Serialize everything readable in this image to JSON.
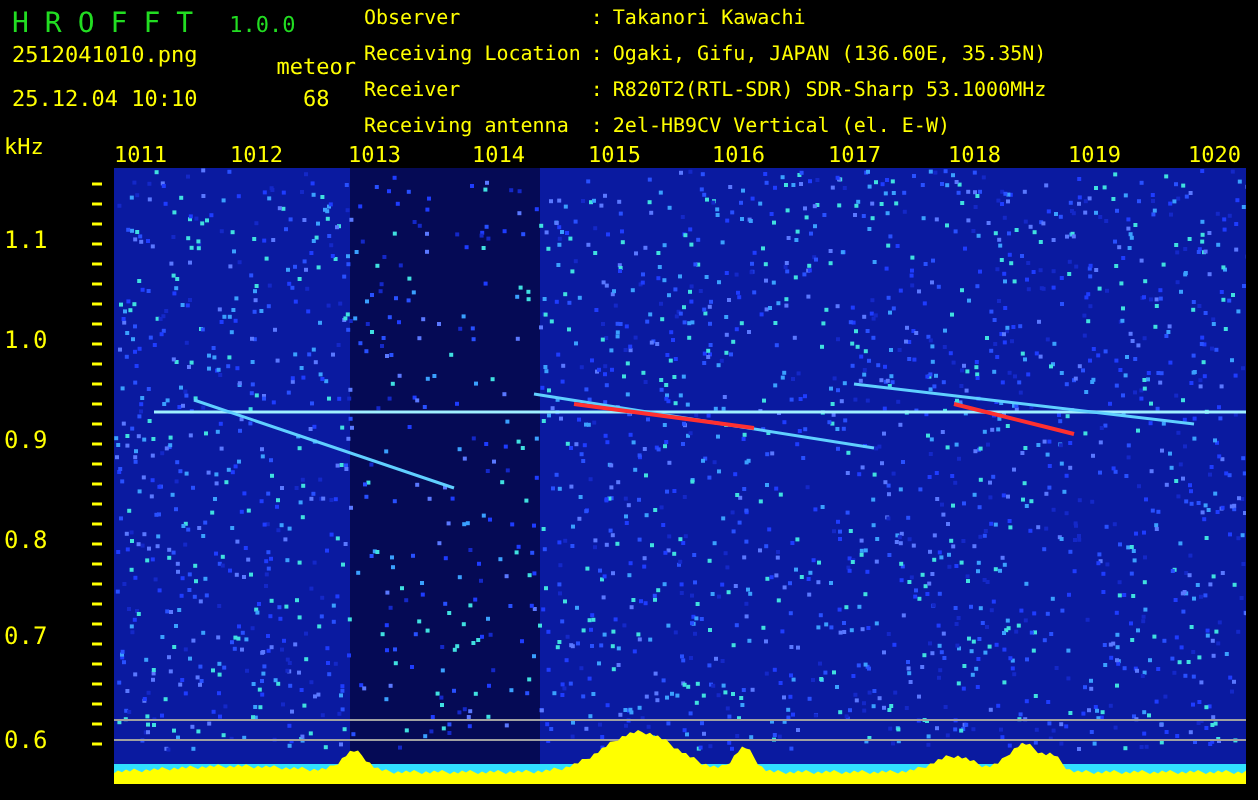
{
  "app": {
    "name": "HROFFT",
    "version": "1.0.0"
  },
  "file": {
    "name": "2512041010.png",
    "datetime": "25.12.04 10:10"
  },
  "meteor": {
    "label": "meteor",
    "count": "68"
  },
  "station": [
    {
      "label": "Observer",
      "separator": ":",
      "value": "Takanori Kawachi"
    },
    {
      "label": "Receiving Location",
      "separator": ":",
      "value": "Ogaki, Gifu, JAPAN (136.60E, 35.35N)"
    },
    {
      "label": "Receiver",
      "separator": ":",
      "value": "R820T2(RTL-SDR) SDR-Sharp 53.1000MHz"
    },
    {
      "label": "Receiving antenna",
      "separator": ":",
      "value": "2el-HB9CV Vertical (el. E-W)"
    }
  ],
  "y_axis": {
    "unit": "kHz",
    "labels": [
      "1.1",
      "1.0",
      "0.9",
      "0.8",
      "0.7",
      "0.6"
    ]
  },
  "x_axis": {
    "labels": [
      "1011",
      "1012",
      "1013",
      "1014",
      "1015",
      "1016",
      "1017",
      "1018",
      "1019",
      "1020"
    ]
  }
}
